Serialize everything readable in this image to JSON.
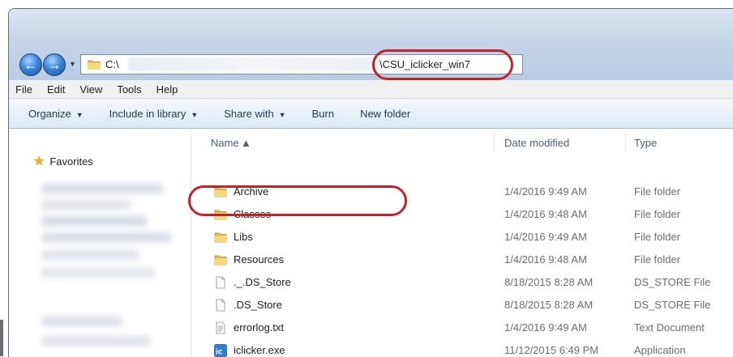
{
  "address": {
    "drive": "C:\\",
    "path_tail": "\\CSU_iclicker_win7"
  },
  "menu": [
    "File",
    "Edit",
    "View",
    "Tools",
    "Help"
  ],
  "toolbar": {
    "organize": "Organize",
    "include": "Include in library",
    "share": "Share with",
    "burn": "Burn",
    "new_folder": "New folder"
  },
  "nav": {
    "favorites": "Favorites"
  },
  "columns": {
    "name": "Name",
    "date": "Date modified",
    "type": "Type"
  },
  "files": [
    {
      "name": "Archive",
      "date": "1/4/2016 9:49 AM",
      "type": "File folder",
      "icon": "folder-icon"
    },
    {
      "name": "Classes",
      "date": "1/4/2016 9:48 AM",
      "type": "File folder",
      "icon": "folder-icon"
    },
    {
      "name": "Libs",
      "date": "1/4/2016 9:49 AM",
      "type": "File folder",
      "icon": "folder-icon"
    },
    {
      "name": "Resources",
      "date": "1/4/2016 9:48 AM",
      "type": "File folder",
      "icon": "folder-icon"
    },
    {
      "name": "._.DS_Store",
      "date": "8/18/2015 8:28 AM",
      "type": "DS_STORE File",
      "icon": "blank-file-icon"
    },
    {
      "name": ".DS_Store",
      "date": "8/18/2015 8:28 AM",
      "type": "DS_STORE File",
      "icon": "blank-file-icon"
    },
    {
      "name": "errorlog.txt",
      "date": "1/4/2016 9:49 AM",
      "type": "Text Document",
      "icon": "text-file-icon"
    },
    {
      "name": "iclicker.exe",
      "date": "11/12/2015 6:49 PM",
      "type": "Application",
      "icon": "iclicker-app-icon"
    }
  ]
}
